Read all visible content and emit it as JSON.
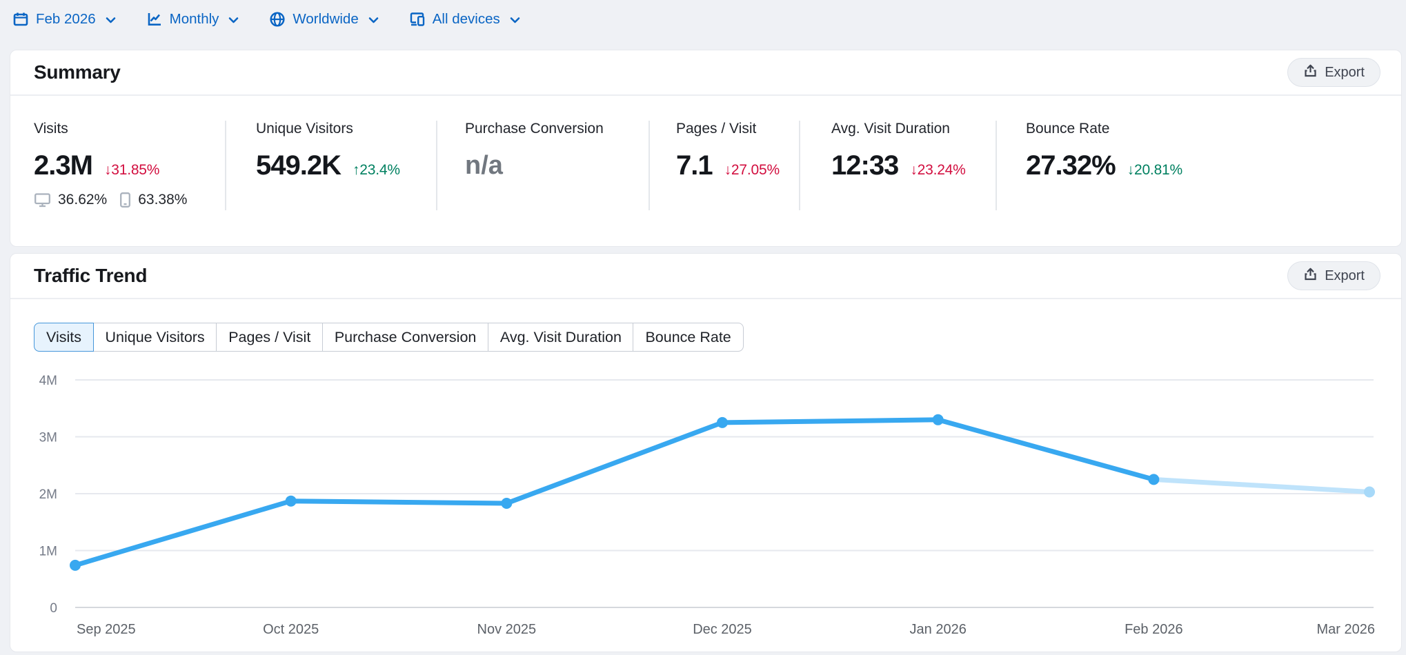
{
  "filters": [
    {
      "id": "date",
      "icon": "calendar-icon",
      "label": "Feb 2026"
    },
    {
      "id": "granularity",
      "icon": "line-chart-icon",
      "label": "Monthly"
    },
    {
      "id": "region",
      "icon": "globe-icon",
      "label": "Worldwide"
    },
    {
      "id": "devices",
      "icon": "devices-icon",
      "label": "All devices"
    }
  ],
  "summary": {
    "title": "Summary",
    "export_label": "Export",
    "metrics": [
      {
        "label": "Visits",
        "value": "2.3M",
        "change": {
          "text": "31.85%",
          "dir": "down",
          "tone": "bad"
        },
        "devices": {
          "desktop": "36.62%",
          "mobile": "63.38%"
        }
      },
      {
        "label": "Unique Visitors",
        "value": "549.2K",
        "change": {
          "text": "23.4%",
          "dir": "up",
          "tone": "good"
        }
      },
      {
        "label": "Purchase Conversion",
        "value": "n/a",
        "na": true
      },
      {
        "label": "Pages / Visit",
        "value": "7.1",
        "change": {
          "text": "27.05%",
          "dir": "down",
          "tone": "bad"
        }
      },
      {
        "label": "Avg. Visit Duration",
        "value": "12:33",
        "change": {
          "text": "23.24%",
          "dir": "down",
          "tone": "bad"
        }
      },
      {
        "label": "Bounce Rate",
        "value": "27.32%",
        "change": {
          "text": "20.81%",
          "dir": "down",
          "tone": "good"
        }
      }
    ]
  },
  "trend": {
    "title": "Traffic Trend",
    "export_label": "Export",
    "tabs": [
      {
        "label": "Visits",
        "active": true
      },
      {
        "label": "Unique Visitors"
      },
      {
        "label": "Pages / Visit"
      },
      {
        "label": "Purchase Conversion"
      },
      {
        "label": "Avg. Visit Duration"
      },
      {
        "label": "Bounce Rate"
      }
    ]
  },
  "chart_data": {
    "type": "line",
    "title": "Traffic Trend - Visits",
    "x_labels": [
      "Sep 2025",
      "Oct 2025",
      "Nov 2025",
      "Dec 2025",
      "Jan 2026",
      "Feb 2026",
      "Mar 2026"
    ],
    "series": [
      {
        "name": "Visits",
        "values_millions": [
          0.74,
          1.87,
          1.83,
          3.25,
          3.3,
          2.25,
          2.03
        ]
      }
    ],
    "forecast_from_index": 5,
    "ylim_millions": [
      0,
      4
    ],
    "yticks": [
      "0",
      "1M",
      "2M",
      "3M",
      "4M"
    ],
    "grid": true,
    "legend": false
  },
  "colors": {
    "accent_blue": "#0a65c4",
    "line_blue": "#38a8f0",
    "forecast_blue": "#bfe3fb",
    "negative_red": "#d20e3f",
    "positive_green": "#008060",
    "grid_line": "#e6e8ee",
    "axis_line": "#d5d8dd"
  }
}
